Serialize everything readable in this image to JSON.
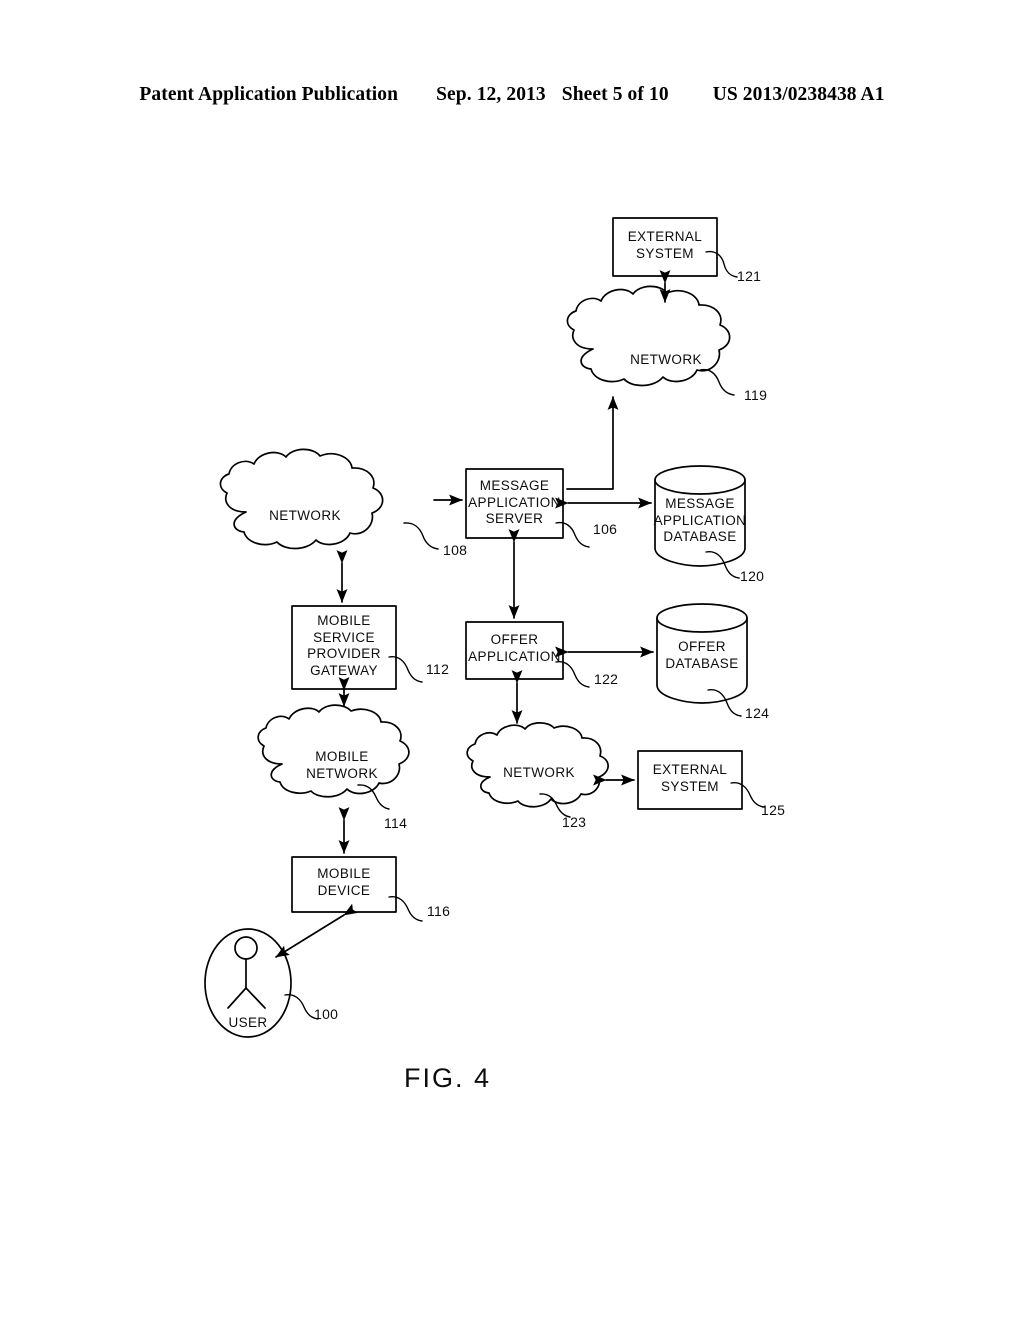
{
  "header": {
    "publication": "Patent Application Publication",
    "date": "Sep. 12, 2013",
    "sheet": "Sheet 5 of 10",
    "patent_number": "US 2013/0238438 A1"
  },
  "figure": {
    "caption": "FIG. 4",
    "line_color": "#000000",
    "background": "#ffffff"
  },
  "nodes": {
    "external_system_top": {
      "label": "EXTERNAL\nSYSTEM",
      "ref": "121",
      "shape": "rectangle"
    },
    "network_119": {
      "label": "NETWORK",
      "ref": "119",
      "shape": "cloud"
    },
    "network_108": {
      "label": "NETWORK",
      "ref": "108",
      "shape": "cloud"
    },
    "message_application_server": {
      "label": "MESSAGE\nAPPLICATION\nSERVER",
      "ref": "106",
      "shape": "rectangle"
    },
    "message_application_database": {
      "label": "MESSAGE\nAPPLICATION\nDATABASE",
      "ref": "120",
      "shape": "cylinder"
    },
    "mobile_service_provider_gateway": {
      "label": "MOBILE\nSERVICE\nPROVIDER\nGATEWAY",
      "ref": "112",
      "shape": "rectangle"
    },
    "offer_application": {
      "label": "OFFER\nAPPLICATION",
      "ref": "122",
      "shape": "rectangle"
    },
    "offer_database": {
      "label": "OFFER\nDATABASE",
      "ref": "124",
      "shape": "cylinder"
    },
    "mobile_network": {
      "label": "MOBILE\nNETWORK",
      "ref": "114",
      "shape": "cloud"
    },
    "network_123": {
      "label": "NETWORK",
      "ref": "123",
      "shape": "cloud"
    },
    "external_system_bottom": {
      "label": "EXTERNAL\nSYSTEM",
      "ref": "125",
      "shape": "rectangle"
    },
    "mobile_device": {
      "label": "MOBILE\nDEVICE",
      "ref": "116",
      "shape": "rectangle"
    },
    "user": {
      "label": "USER",
      "ref": "100",
      "shape": "ellipse-actor"
    }
  },
  "connections": [
    {
      "from": "external_system_top",
      "to": "network_119",
      "type": "bidirectional"
    },
    {
      "from": "message_application_server",
      "to": "network_119",
      "type": "directed"
    },
    {
      "from": "network_108",
      "to": "message_application_server",
      "type": "directed"
    },
    {
      "from": "message_application_server",
      "to": "message_application_database",
      "type": "bidirectional"
    },
    {
      "from": "network_108",
      "to": "mobile_service_provider_gateway",
      "type": "bidirectional"
    },
    {
      "from": "message_application_server",
      "to": "offer_application",
      "type": "bidirectional"
    },
    {
      "from": "offer_application",
      "to": "offer_database",
      "type": "bidirectional"
    },
    {
      "from": "mobile_service_provider_gateway",
      "to": "mobile_network",
      "type": "bidirectional"
    },
    {
      "from": "offer_application",
      "to": "network_123",
      "type": "bidirectional"
    },
    {
      "from": "network_123",
      "to": "external_system_bottom",
      "type": "bidirectional"
    },
    {
      "from": "mobile_network",
      "to": "mobile_device",
      "type": "bidirectional"
    },
    {
      "from": "mobile_device",
      "to": "user",
      "type": "bidirectional"
    }
  ]
}
